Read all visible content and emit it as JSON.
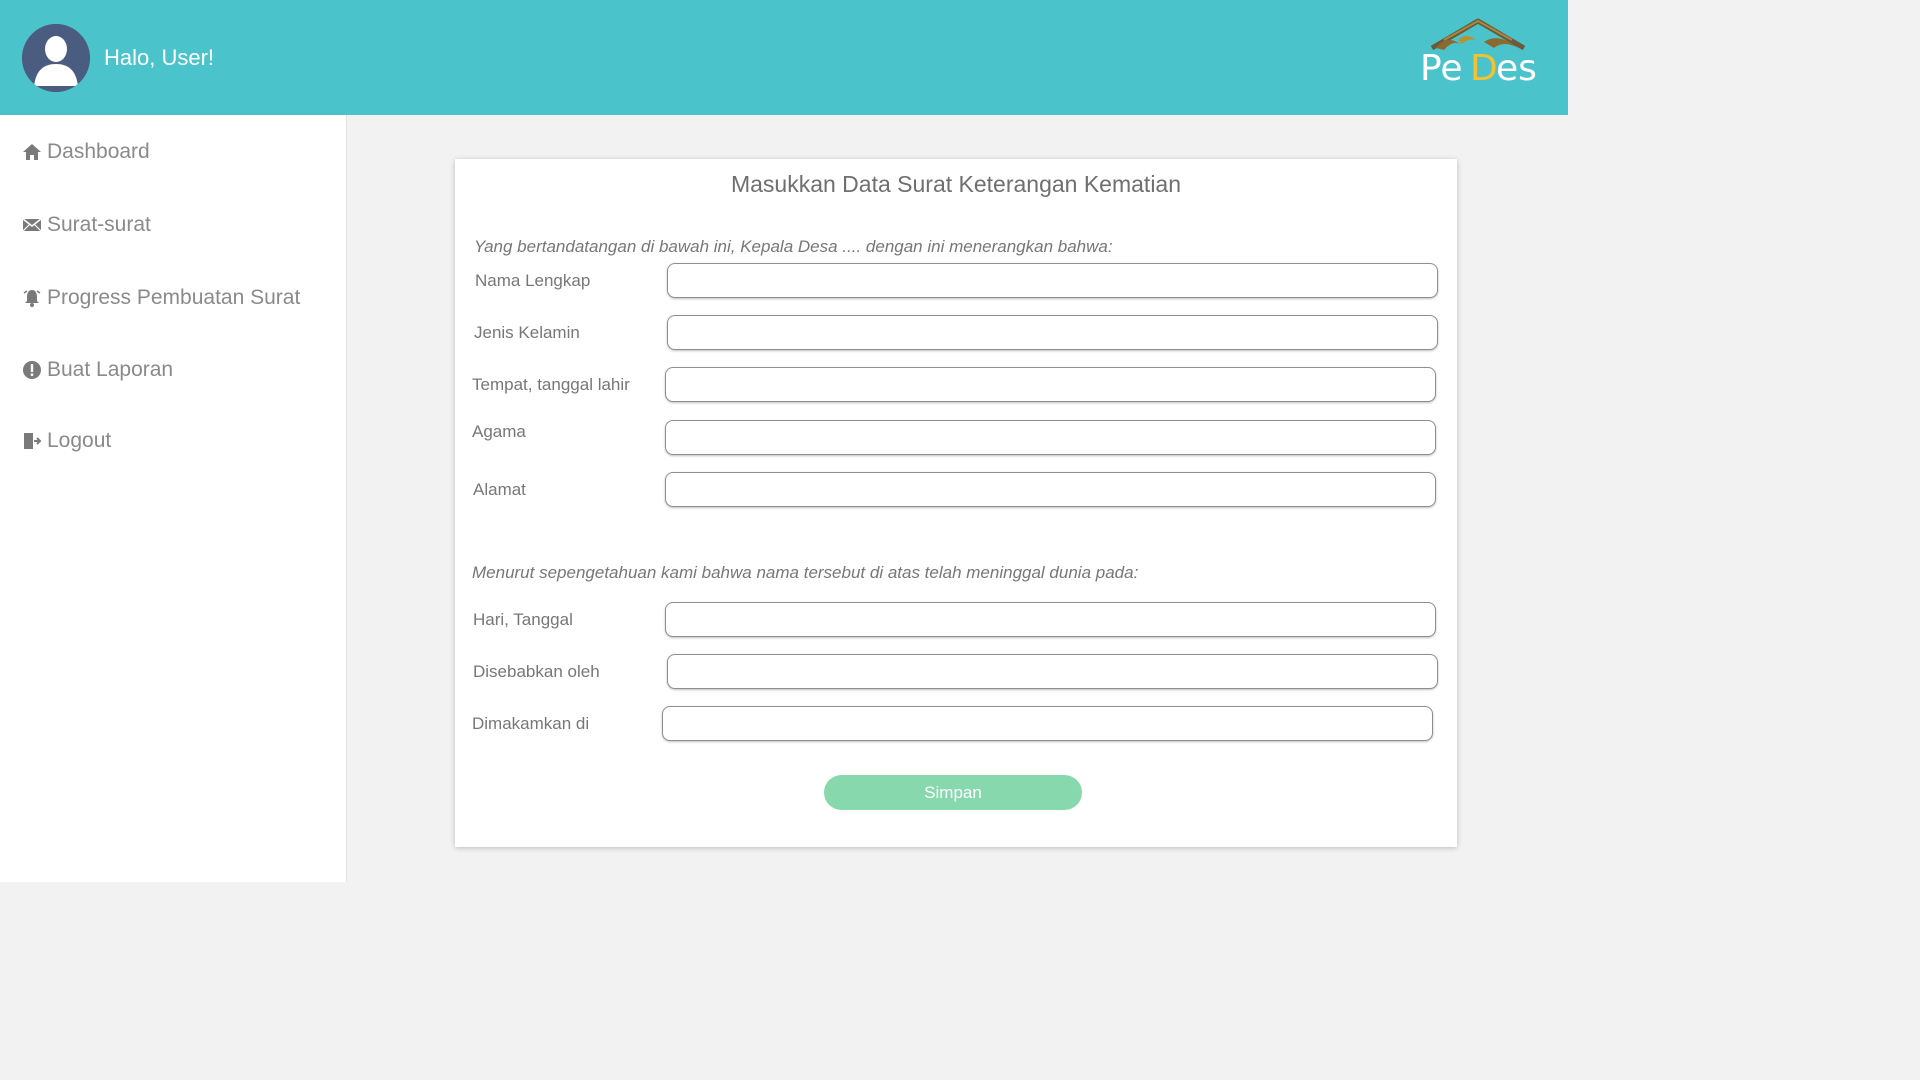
{
  "header": {
    "greeting": "Halo, User!",
    "logo_text": "PeDes",
    "colors": {
      "bar": "#4bc3cb",
      "avatar": "#4a5c80"
    }
  },
  "sidebar": {
    "items": [
      {
        "label": "Dashboard",
        "icon": "home-icon"
      },
      {
        "label": "Surat-surat",
        "icon": "envelope-icon"
      },
      {
        "label": "Progress Pembuatan Surat",
        "icon": "bell-icon"
      },
      {
        "label": "Buat Laporan",
        "icon": "exclamation-circle-icon"
      },
      {
        "label": "Logout",
        "icon": "sign-out-icon"
      }
    ]
  },
  "form": {
    "title": "Masukkan Data Surat Keterangan Kematian",
    "intro_1": "Yang bertandatangan di bawah ini, Kepala Desa .... dengan ini menerangkan bahwa:",
    "intro_2": "Menurut sepengetahuan kami bahwa nama tersebut di atas telah meninggal dunia pada:",
    "fields": [
      {
        "label": "Nama Lengkap",
        "value": ""
      },
      {
        "label": "Jenis Kelamin",
        "value": ""
      },
      {
        "label": "Tempat, tanggal lahir",
        "value": ""
      },
      {
        "label": "Agama",
        "value": ""
      },
      {
        "label": "Alamat",
        "value": ""
      },
      {
        "label": "Hari, Tanggal",
        "value": ""
      },
      {
        "label": "Disebabkan oleh",
        "value": ""
      },
      {
        "label": "Dimakamkan di",
        "value": ""
      }
    ],
    "submit_label": "Simpan",
    "submit_color": "#87d8ad"
  }
}
